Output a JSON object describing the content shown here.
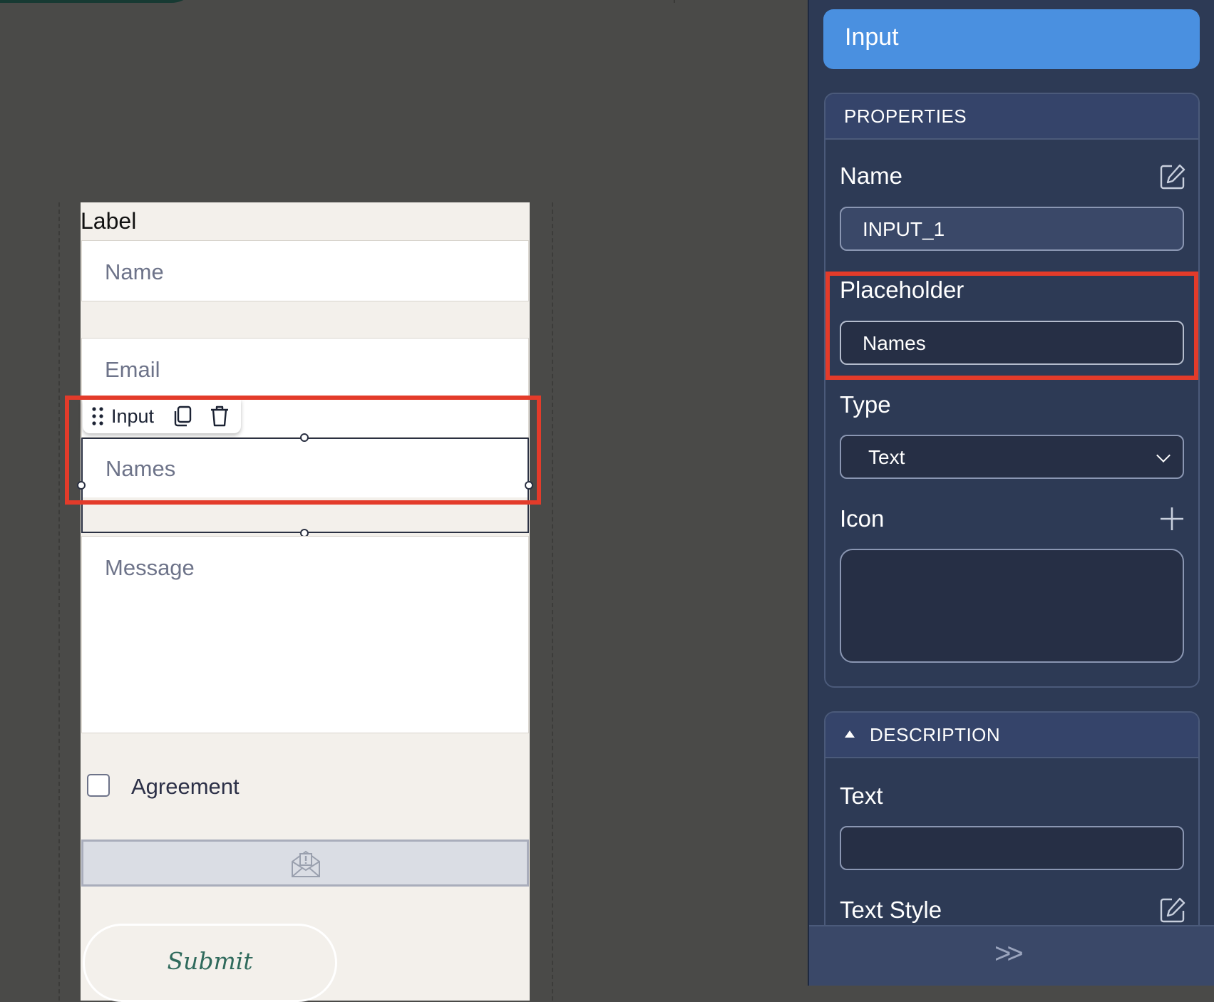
{
  "canvas": {
    "form_label": "Label",
    "fields": {
      "name_placeholder": "Name",
      "email_placeholder": "Email",
      "selected_placeholder": "Names",
      "message_placeholder": "Message"
    },
    "element_toolbar": {
      "label": "Input"
    },
    "checkbox_label": "Agreement",
    "submit_label": "Submit"
  },
  "panel": {
    "title": "Input",
    "properties": {
      "header": "PROPERTIES",
      "name_label": "Name",
      "name_value": "INPUT_1",
      "placeholder_label": "Placeholder",
      "placeholder_value": "Names",
      "type_label": "Type",
      "type_value": "Text",
      "icon_label": "Icon"
    },
    "description": {
      "header": "DESCRIPTION",
      "text_label": "Text",
      "text_value": "",
      "text_style_label": "Text Style"
    },
    "collapse_glyph": ">>"
  },
  "colors": {
    "highlight": "#e33b2a",
    "panel_bg": "#2d3a55",
    "accent": "#4a90e0",
    "submit_text": "#2f6a5c"
  }
}
